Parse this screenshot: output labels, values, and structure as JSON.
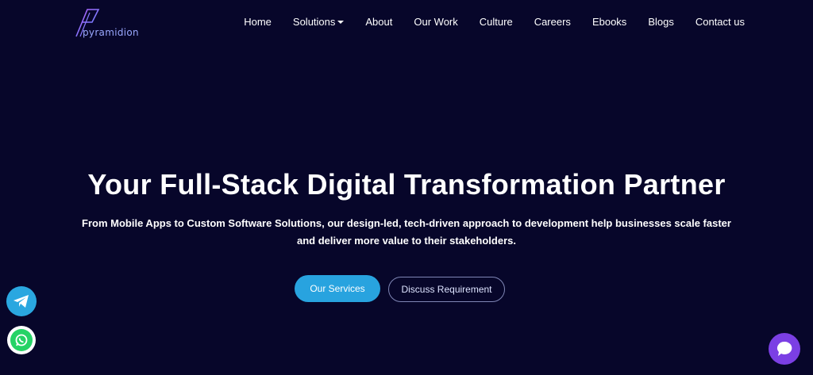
{
  "header": {
    "logo_text": "pyramidion",
    "nav": [
      {
        "label": "Home"
      },
      {
        "label": "Solutions"
      },
      {
        "label": "About"
      },
      {
        "label": "Our Work"
      },
      {
        "label": "Culture"
      },
      {
        "label": "Careers"
      },
      {
        "label": "Ebooks"
      },
      {
        "label": "Blogs"
      },
      {
        "label": "Contact us"
      }
    ]
  },
  "hero": {
    "title": "Your Full-Stack Digital Transformation Partner",
    "subtitle_line1": "From Mobile Apps to Custom Software Solutions, our design-led, tech-driven approach to development help businesses scale faster",
    "subtitle_line2": "and deliver more value to their stakeholders.",
    "primary_button": "Our Services",
    "secondary_button": "Discuss Requirement"
  },
  "floating": {
    "telegram_icon": "telegram-icon",
    "whatsapp_icon": "whatsapp-icon",
    "chat_icon": "chat-icon"
  },
  "colors": {
    "background": "#07062a",
    "primary_button": "#28a3df",
    "chat_widget": "#7b3fe4",
    "whatsapp": "#25d366",
    "telegram": "#2aa7e0"
  }
}
